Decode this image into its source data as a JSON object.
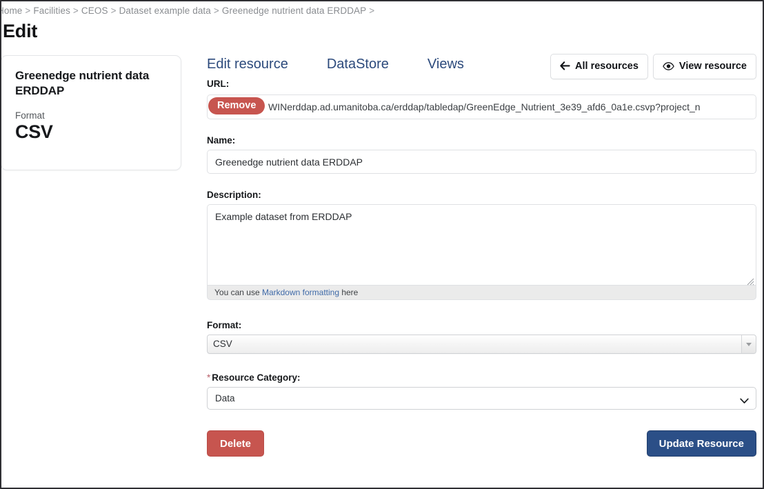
{
  "breadcrumb": {
    "items": [
      "Home",
      "Facilities",
      "CEOS",
      "Dataset example data",
      "Greenedge nutrient data ERDDAP"
    ],
    "separator": ">",
    "trailing_separator": ">"
  },
  "page": {
    "title": "Edit"
  },
  "sidebar": {
    "resource_name": "Greenedge nutrient data ERDDAP",
    "format_label": "Format",
    "format_value": "CSV"
  },
  "tabs": [
    {
      "label": "Edit resource"
    },
    {
      "label": "DataStore"
    },
    {
      "label": "Views"
    }
  ],
  "header_buttons": {
    "all_resources": {
      "label": "All resources",
      "icon": "arrow-left-icon"
    },
    "view_resource": {
      "label": "View resource",
      "icon": "eye-icon"
    }
  },
  "form": {
    "url": {
      "label": "URL:",
      "remove_label": "Remove",
      "value": "WINerddap.ad.umanitoba.ca/erddap/tabledap/GreenEdge_Nutrient_3e39_afd6_0a1e.csvp?project_n"
    },
    "name": {
      "label": "Name:",
      "value": "Greenedge nutrient data ERDDAP",
      "placeholder": ""
    },
    "description": {
      "label": "Description:",
      "value": "Example dataset from ERDDAP",
      "placeholder": "",
      "help_prefix": "You can use ",
      "help_link": "Markdown formatting",
      "help_suffix": " here"
    },
    "format": {
      "label": "Format:",
      "value": "CSV"
    },
    "resource_category": {
      "required_marker": "*",
      "label": "Resource Category:",
      "value": "Data",
      "options": [
        "Data"
      ]
    }
  },
  "actions": {
    "delete_label": "Delete",
    "update_label": "Update Resource"
  },
  "colors": {
    "danger": "#c7554f",
    "primary": "#2b4f87",
    "tab_link": "#2c4a7c",
    "link": "#3f6aa8",
    "required_star": "#b9606a",
    "breadcrumb_text": "#8a8d91"
  }
}
